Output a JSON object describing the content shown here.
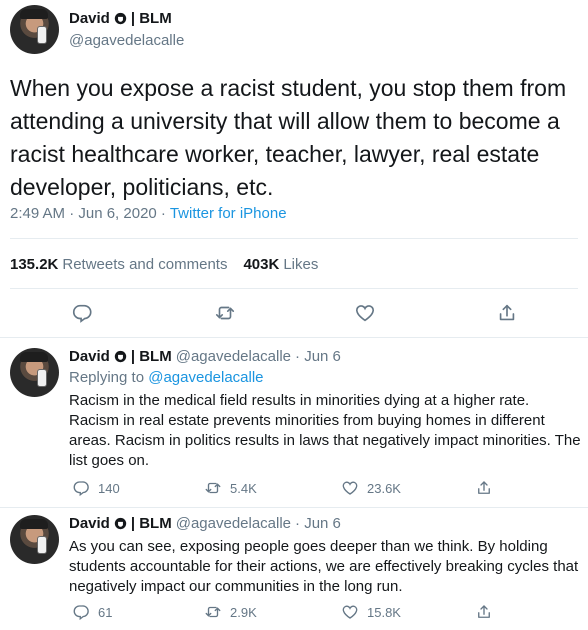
{
  "main_tweet": {
    "author_name": "David",
    "author_suffix": "| BLM",
    "handle": "@agavedelacalle",
    "text": "When you expose a racist student, you stop them from attending a university that will allow them to become a racist healthcare worker, teacher, lawyer, real estate developer, politicians, etc.",
    "timestamp": "2:49 AM · Jun 6, 2020 · ",
    "source": "Twitter for iPhone",
    "retweets_count": "135.2K",
    "retweets_label": "Retweets and comments",
    "likes_count": "403K",
    "likes_label": "Likes"
  },
  "replies": [
    {
      "author_name": "David",
      "author_suffix": "| BLM",
      "handle": "@agavedelacalle",
      "date": "· Jun 6",
      "replying_prefix": "Replying to ",
      "replying_to": "@agavedelacalle",
      "text": "Racism in the medical field results in minorities dying at a higher rate. Racism in real estate prevents minorities from buying homes in different areas. Racism in politics results in laws that negatively impact minorities. The list goes on.",
      "reply_count": "140",
      "retweet_count": "5.4K",
      "like_count": "23.6K"
    },
    {
      "author_name": "David",
      "author_suffix": "| BLM",
      "handle": "@agavedelacalle",
      "date": "· Jun 6",
      "text": "As you can see, exposing people goes deeper than we think. By holding students accountable for their actions, we are effectively breaking cycles that negatively impact our communities in the long run.",
      "reply_count": "61",
      "retweet_count": "2.9K",
      "like_count": "15.8K"
    }
  ],
  "icons": {
    "badge": "raised-fist-badge-icon",
    "reply": "comment-icon",
    "retweet": "retweet-icon",
    "like": "heart-icon",
    "share": "share-icon"
  },
  "colors": {
    "text": "#14171a",
    "muted": "#657786",
    "link": "#1b95e0",
    "divider": "#e6ecf0"
  }
}
